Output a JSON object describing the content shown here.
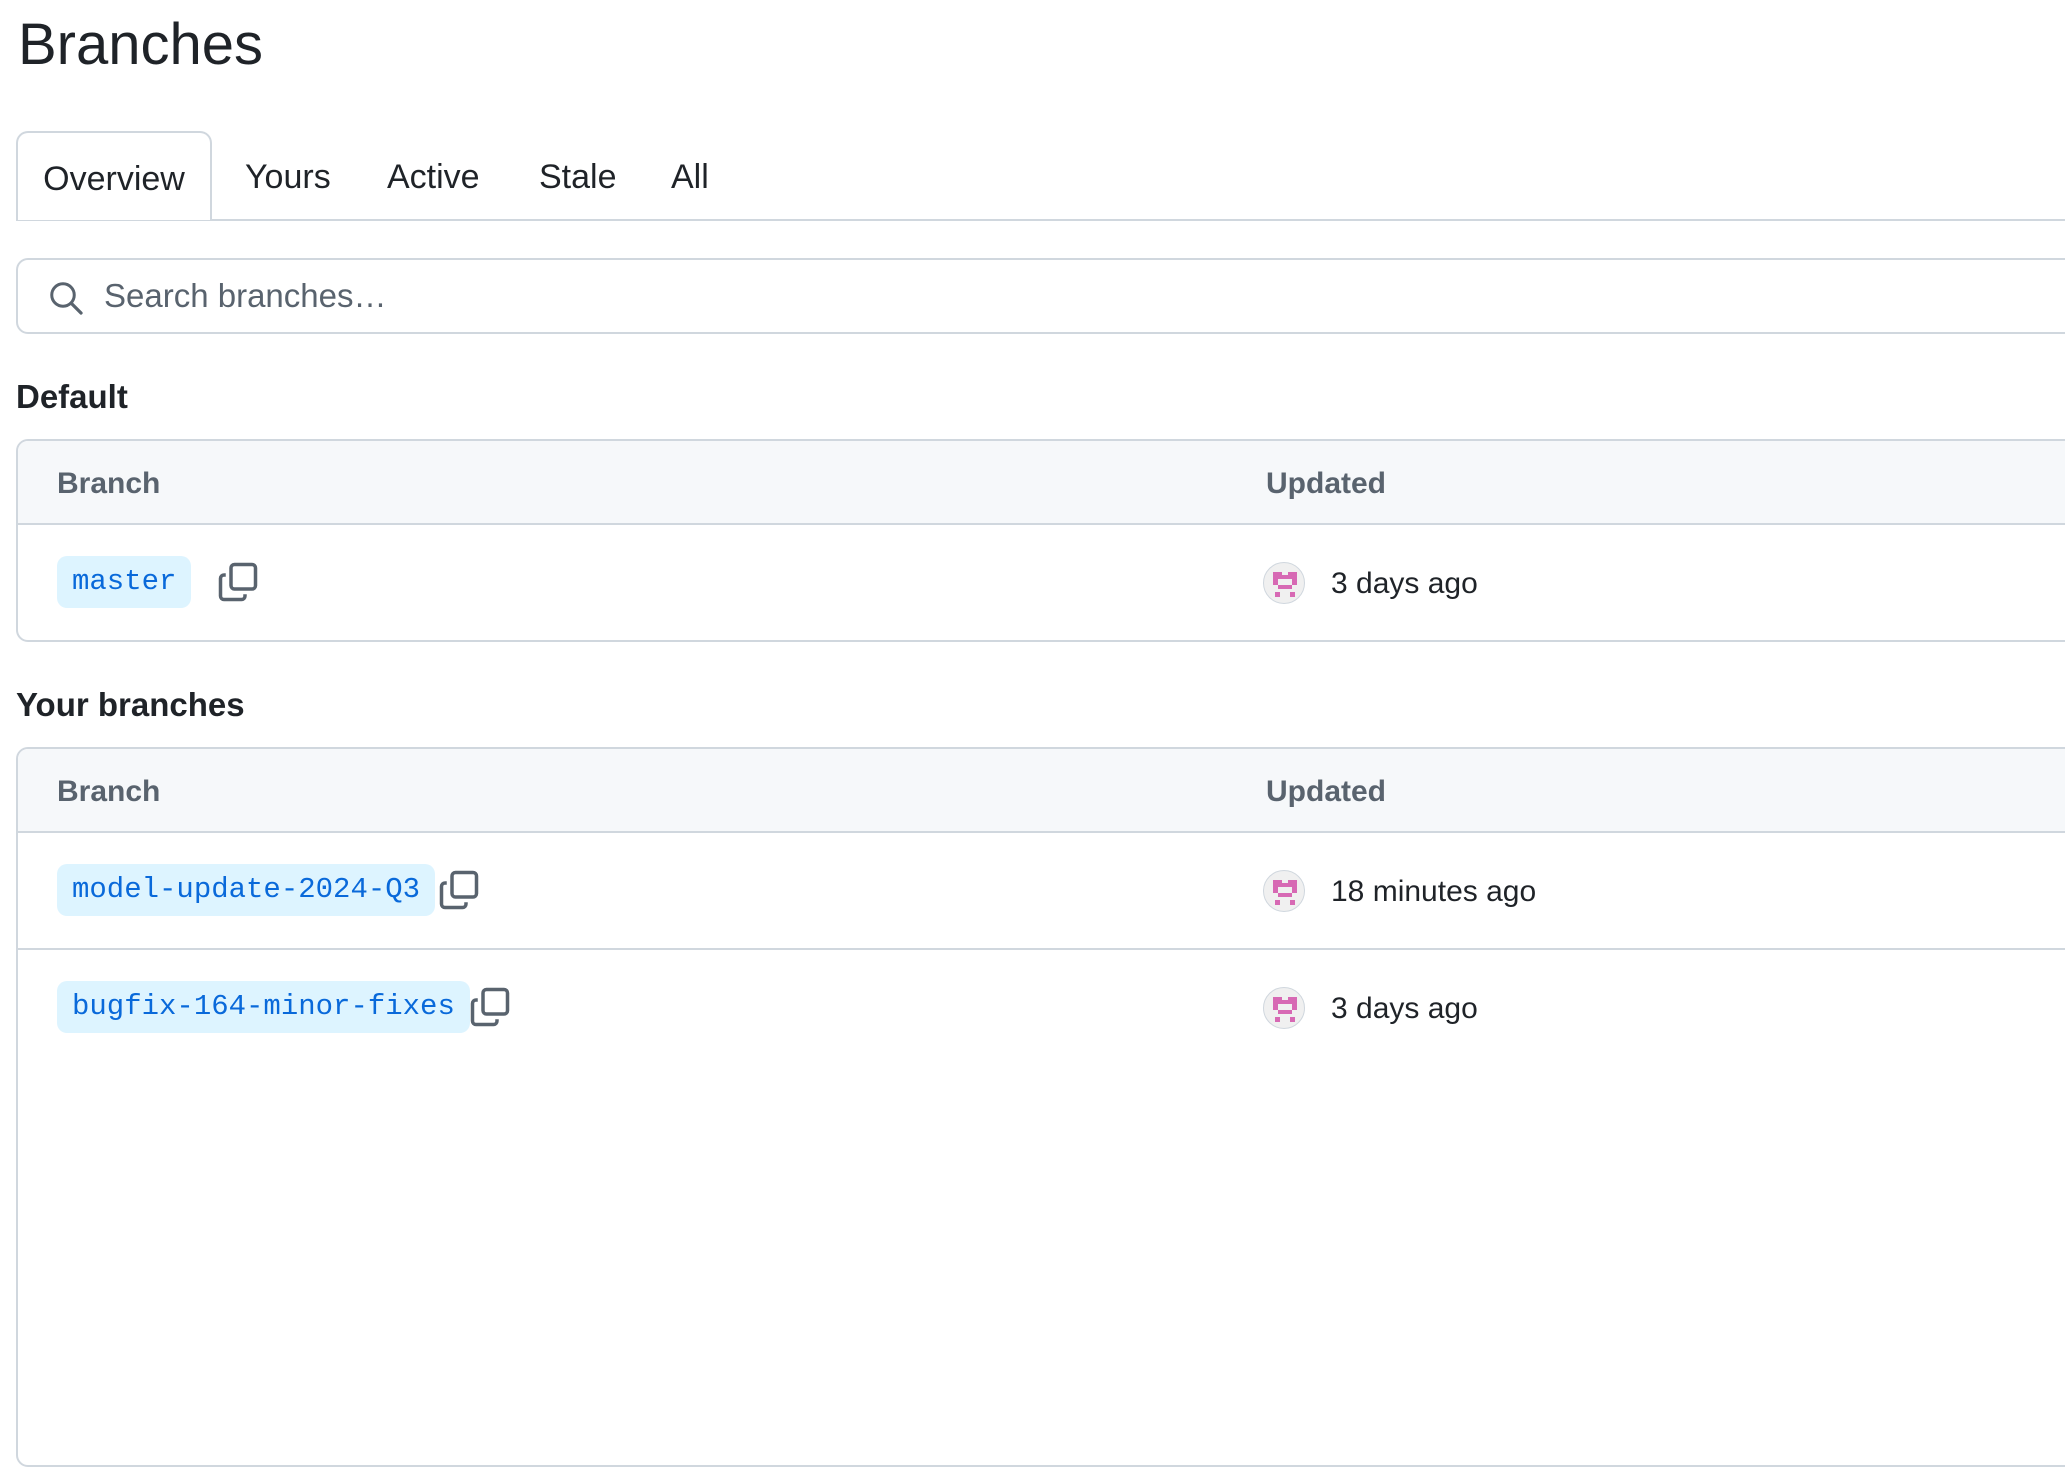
{
  "page": {
    "title": "Branches"
  },
  "tabs": [
    {
      "label": "Overview",
      "active": true
    },
    {
      "label": "Yours",
      "active": false
    },
    {
      "label": "Active",
      "active": false
    },
    {
      "label": "Stale",
      "active": false
    },
    {
      "label": "All",
      "active": false
    }
  ],
  "search": {
    "placeholder": "Search branches…",
    "value": ""
  },
  "default_section": {
    "title": "Default",
    "columns": {
      "branch": "Branch",
      "updated": "Updated"
    },
    "rows": [
      {
        "branch": "master",
        "updated": "3 days ago"
      }
    ]
  },
  "yours_section": {
    "title": "Your branches",
    "columns": {
      "branch": "Branch",
      "updated": "Updated"
    },
    "rows": [
      {
        "branch": "model-update-2024-Q3",
        "updated": "18 minutes ago"
      },
      {
        "branch": "bugfix-164-minor-fixes",
        "updated": "3 days ago"
      }
    ]
  },
  "colors": {
    "accent": "#0969da",
    "tag_bg": "#ddf4ff",
    "border": "#d0d7de",
    "avatar": "#d769b4"
  }
}
